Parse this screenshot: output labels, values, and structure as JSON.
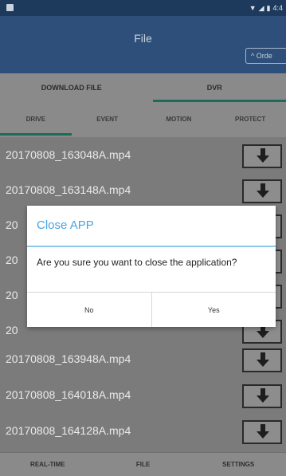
{
  "status_bar": {
    "icons": [
      "wifi-icon",
      "signal-icon",
      "battery-icon"
    ],
    "time": "4:4"
  },
  "header": {
    "title": "File",
    "order_label": "^ Orde"
  },
  "top_tabs": [
    {
      "label": "DOWNLOAD FILE",
      "active": false
    },
    {
      "label": "DVR",
      "active": true
    }
  ],
  "sub_tabs": [
    {
      "label": "DRIVE",
      "active": true
    },
    {
      "label": "EVENT",
      "active": false
    },
    {
      "label": "MOTION",
      "active": false
    },
    {
      "label": "PROTECT",
      "active": false
    }
  ],
  "files": [
    {
      "name": "20170808_163048A.mp4"
    },
    {
      "name": "20170808_163148A.mp4"
    },
    {
      "name": "20"
    },
    {
      "name": "20"
    },
    {
      "name": "20"
    },
    {
      "name": "20"
    },
    {
      "name": "20170808_163948A.mp4"
    },
    {
      "name": "20170808_164018A.mp4"
    },
    {
      "name": "20170808_164128A.mp4"
    }
  ],
  "bottom_nav": [
    {
      "label": "REAL-TIME"
    },
    {
      "label": "FILE"
    },
    {
      "label": "SETTINGS"
    }
  ],
  "dialog": {
    "title": "Close APP",
    "message": "Are you sure you want to close the application?",
    "no_label": "No",
    "yes_label": "Yes"
  },
  "colors": {
    "header": "#2d4f7a",
    "status_bar": "#1d3a5c",
    "accent_tab": "#1d6b5a",
    "dialog_title": "#4aa3e0"
  }
}
